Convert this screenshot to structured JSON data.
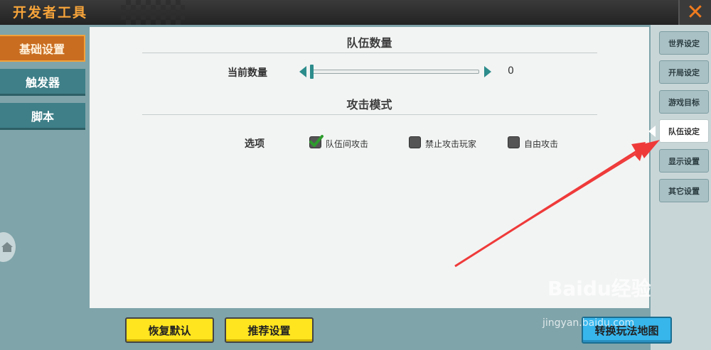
{
  "window": {
    "title": "开发者工具",
    "close_symbol": "✕"
  },
  "left_tabs": [
    {
      "label": "基础设置",
      "active": true
    },
    {
      "label": "触发器",
      "active": false
    },
    {
      "label": "脚本",
      "active": false
    }
  ],
  "team_count": {
    "section_title": "队伍数量",
    "row_label": "当前数量",
    "value": "0"
  },
  "attack_mode": {
    "section_title": "攻击模式",
    "row_label": "选项",
    "options": [
      {
        "label": "队伍间攻击",
        "checked": true
      },
      {
        "label": "禁止攻击玩家",
        "checked": false
      },
      {
        "label": "自由攻击",
        "checked": false
      }
    ]
  },
  "right_tabs": [
    {
      "label": "世界设定",
      "active": false
    },
    {
      "label": "开局设定",
      "active": false
    },
    {
      "label": "游戏目标",
      "active": false
    },
    {
      "label": "队伍设定",
      "active": true
    },
    {
      "label": "显示设置",
      "active": false
    },
    {
      "label": "其它设置",
      "active": false
    }
  ],
  "bottom": {
    "restore_default": "恢复默认",
    "recommended": "推荐设置",
    "switch_mode": "转换玩法地图"
  },
  "watermark": {
    "brand": "Baidu经验",
    "url": "jingyan.baidu.com"
  },
  "colors": {
    "accent_orange": "#c96d20",
    "teal": "#3e7f88",
    "yellow": "#ffe51f",
    "blue": "#37b6ec",
    "arrow": "#ef3a3a"
  }
}
